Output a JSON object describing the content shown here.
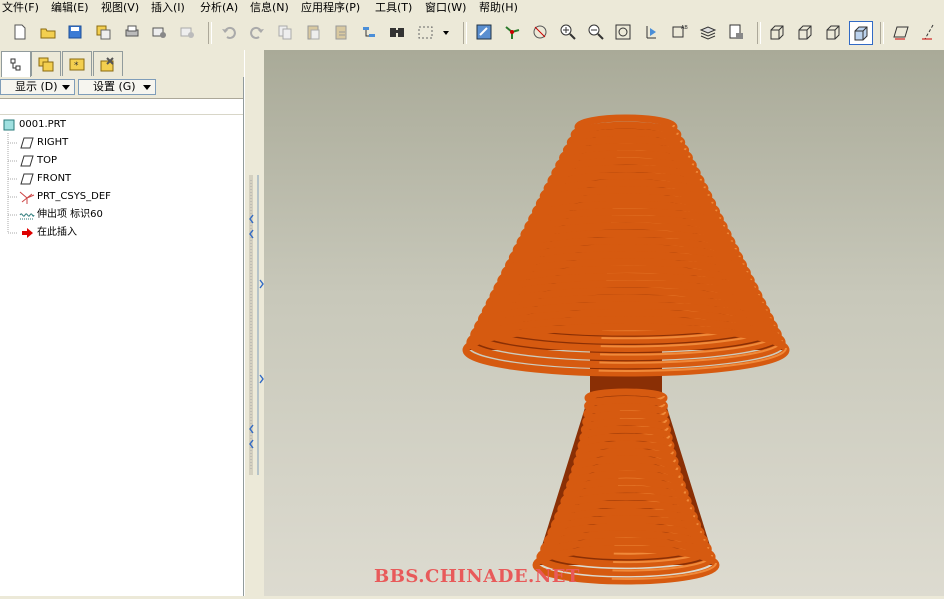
{
  "menu": [
    {
      "label": "文件(F)"
    },
    {
      "label": "编辑(E)"
    },
    {
      "label": "视图(V)"
    },
    {
      "label": "插入(I)"
    },
    {
      "label": "分析(A)"
    },
    {
      "label": "信息(N)"
    },
    {
      "label": "应用程序(P)"
    },
    {
      "label": "工具(T)"
    },
    {
      "label": "窗口(W)"
    },
    {
      "label": "帮助(H)"
    }
  ],
  "toolbar": {
    "icons": [
      "new-icon",
      "open-icon",
      "save-icon",
      "save-copy-icon",
      "print-icon",
      "send-mail-icon",
      "send-mail-2-icon",
      "undo-icon",
      "redo-icon",
      "copy-icon",
      "paste-icon",
      "paste-special-icon",
      "regenerate-icon",
      "find-icon",
      "select-box-icon",
      "repaint-icon",
      "spin-center-icon",
      "view-mode-icon",
      "zoom-in-icon",
      "zoom-out-icon",
      "refit-icon",
      "reorient-icon",
      "saved-views-icon",
      "layers-icon",
      "view-manager-icon",
      "wireframe-icon",
      "hidden-line-icon",
      "no-hidden-icon",
      "shading-icon",
      "datum-plane-display-icon",
      "datum-axis-display-icon"
    ]
  },
  "nav_tabs": [
    "model-tree-tab",
    "folder-browser-tab",
    "favorites-tab",
    "connections-tab"
  ],
  "tree_header": {
    "show_label": "显示 (D)",
    "settings_label": "设置 (G)"
  },
  "tree": [
    {
      "label": "0001.PRT",
      "icon": "part-icon"
    },
    {
      "label": "RIGHT",
      "icon": "datum-plane-icon"
    },
    {
      "label": "TOP",
      "icon": "datum-plane-icon"
    },
    {
      "label": "FRONT",
      "icon": "datum-plane-icon"
    },
    {
      "label": "PRT_CSYS_DEF",
      "icon": "csys-icon"
    },
    {
      "label": "伸出项 标识60",
      "icon": "protrusion-icon"
    },
    {
      "label": "在此插入",
      "icon": "insert-here-arrow-icon"
    }
  ],
  "watermark": "BBS.CHINADE.NET",
  "colors": {
    "coil": "#d65a10",
    "coil_highlight": "#f08a3a",
    "coil_shadow": "#8a2f05",
    "bg_top": "#a9aa98",
    "bg_bottom": "#dddbd0"
  }
}
